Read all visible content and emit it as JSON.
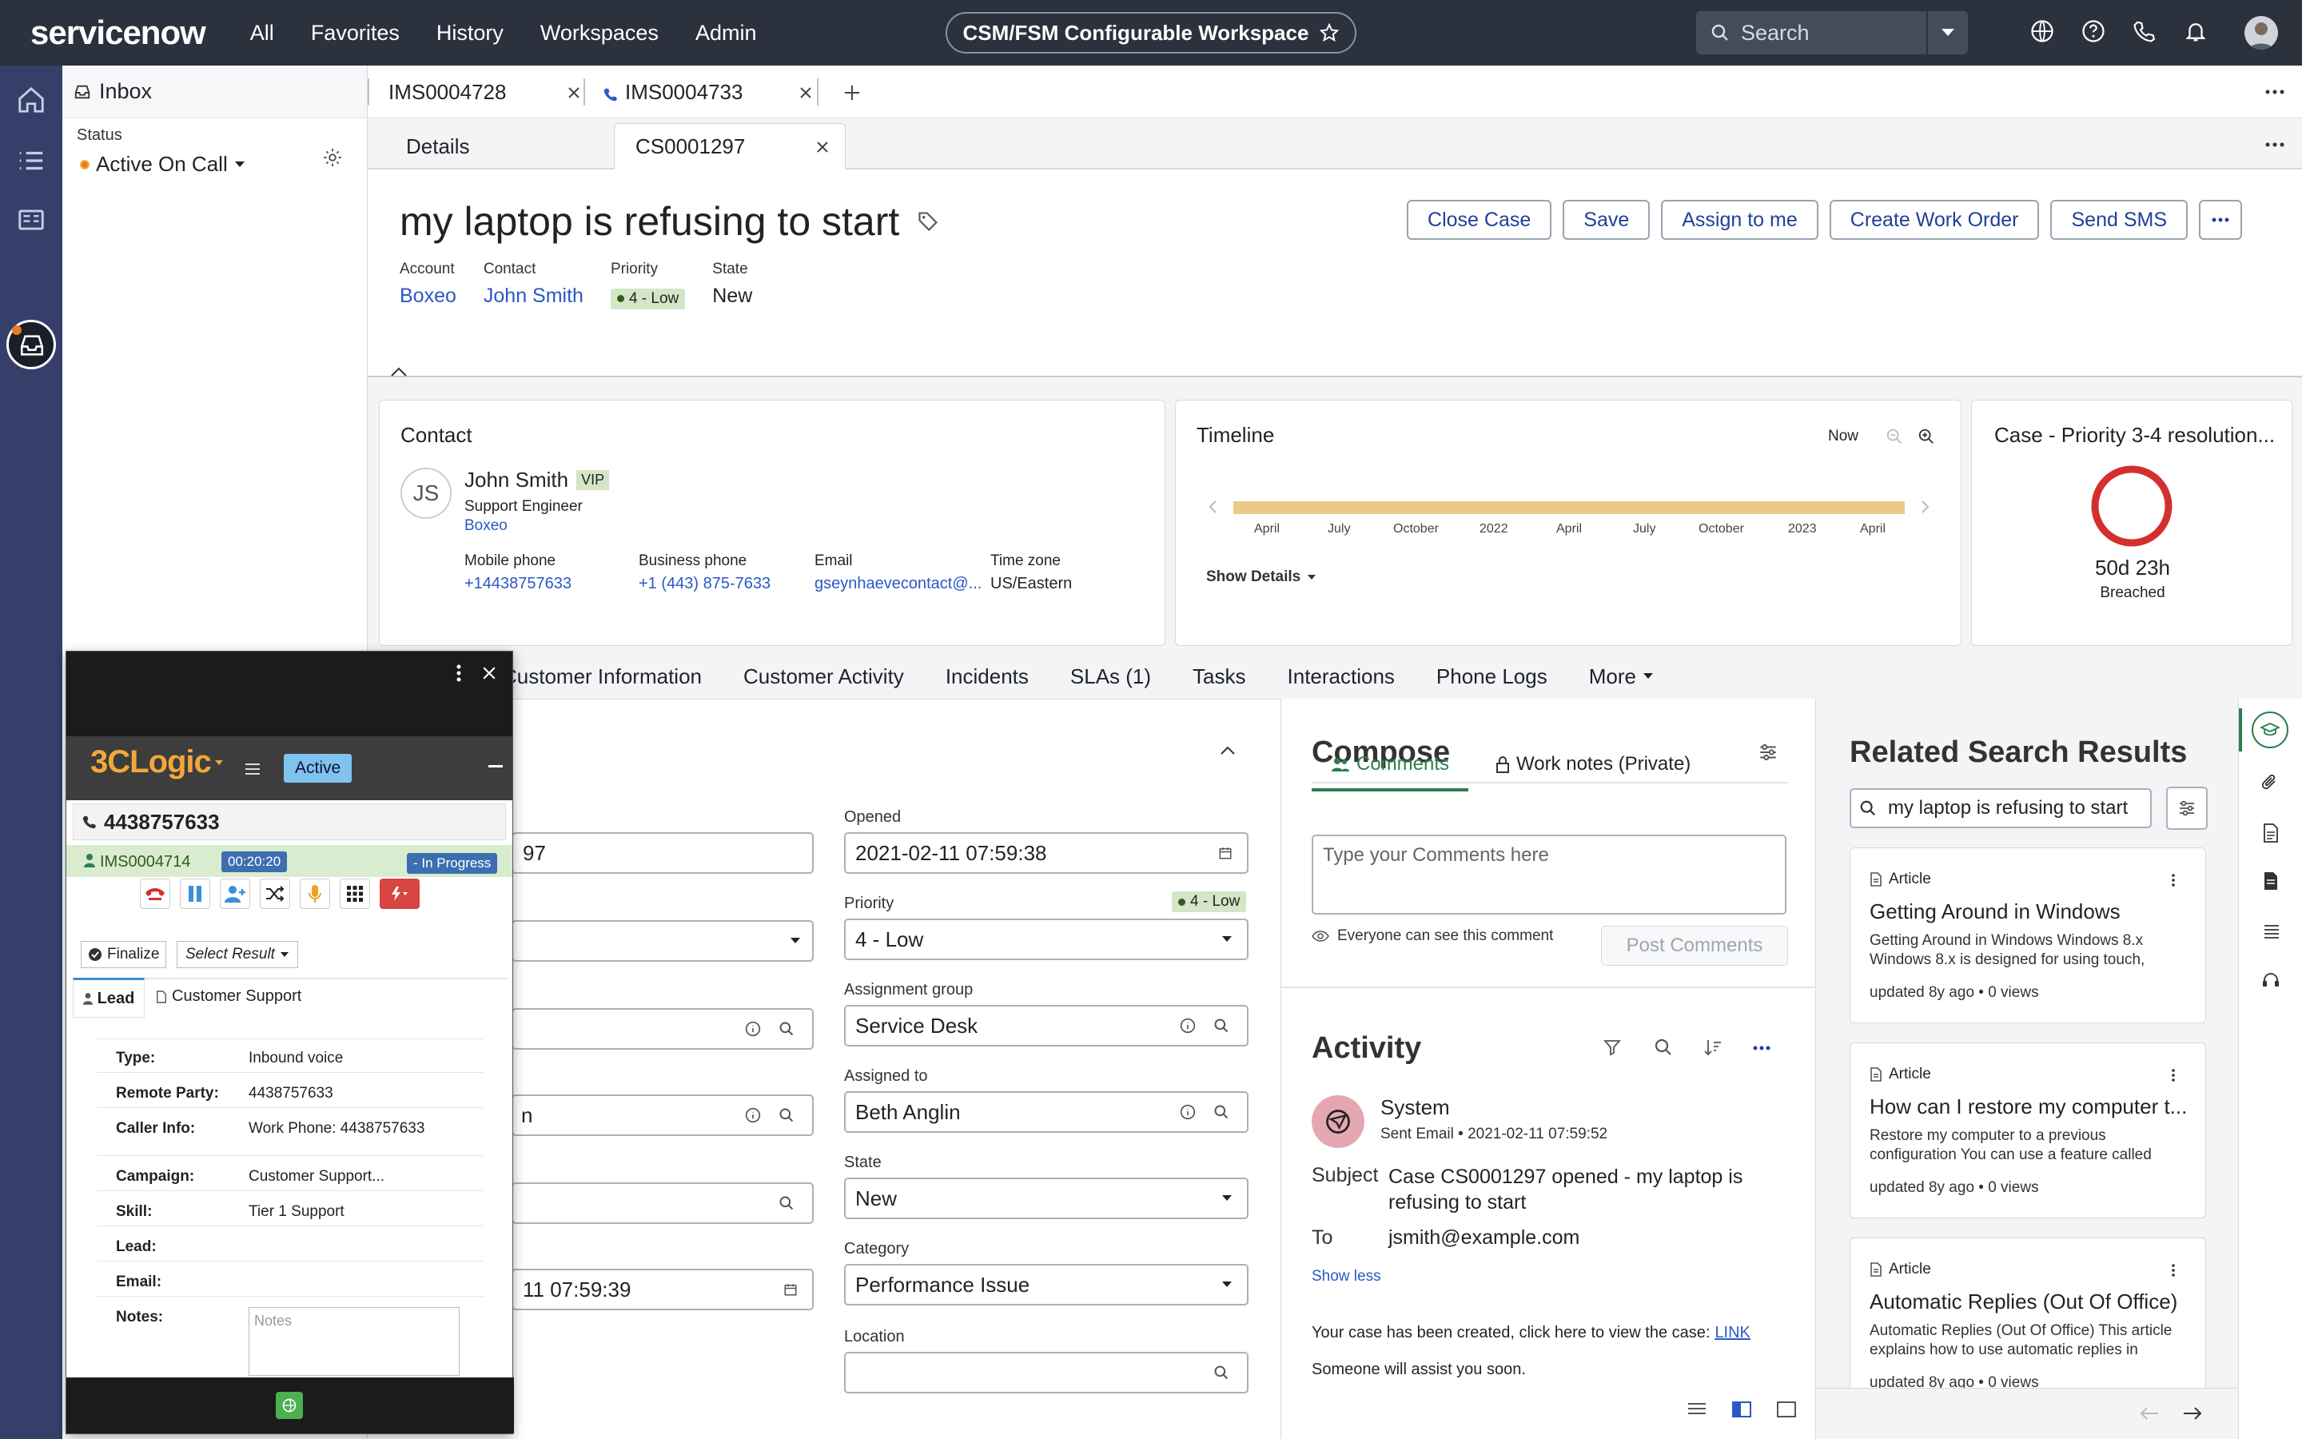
{
  "topnav": {
    "logo": "servicenow",
    "links": [
      "All",
      "Favorites",
      "History",
      "Workspaces",
      "Admin"
    ],
    "workspace": "CSM/FSM Configurable Workspace",
    "search_placeholder": "Search"
  },
  "inbox": {
    "title": "Inbox",
    "status_label": "Status",
    "status_value": "Active On Call"
  },
  "tabs": {
    "primary": [
      "IMS0004728",
      "IMS0004733"
    ],
    "secondary": [
      "Details",
      "CS0001297"
    ]
  },
  "case": {
    "title": "my laptop is refusing to start",
    "buttons": [
      "Close Case",
      "Save",
      "Assign to me",
      "Create Work Order",
      "Send SMS"
    ],
    "account_label": "Account",
    "account": "Boxeo",
    "contact_label": "Contact",
    "contact": "John Smith",
    "priority_label": "Priority",
    "priority": "4 - Low",
    "state_label": "State",
    "state": "New"
  },
  "contact_card": {
    "title": "Contact",
    "initials": "JS",
    "name": "John Smith",
    "vip": "VIP",
    "role": "Support Engineer",
    "company": "Boxeo",
    "mobile_label": "Mobile phone",
    "mobile": "+14438757633",
    "business_label": "Business phone",
    "business": "+1 (443) 875-7633",
    "email_label": "Email",
    "email": "gseynhaevecontact@...",
    "tz_label": "Time zone",
    "tz": "US/Eastern"
  },
  "timeline": {
    "title": "Timeline",
    "now": "Now",
    "ticks": [
      "April",
      "July",
      "October",
      "2022",
      "April",
      "July",
      "October",
      "2023",
      "April"
    ],
    "show_details": "Show Details"
  },
  "sla": {
    "title": "Case - Priority 3-4 resolution...",
    "time": "50d 23h",
    "status": "Breached",
    "ring_color": "#d32f2f"
  },
  "related_tabs": [
    "Customer Information",
    "Customer Activity",
    "Incidents",
    "SLAs (1)",
    "Tasks",
    "Interactions",
    "Phone Logs",
    "More"
  ],
  "form": {
    "number_value": "97",
    "opened_label": "Opened",
    "opened": "2021-02-11 07:59:38",
    "priority_label": "Priority",
    "priority": "4 - Low",
    "priority_badge": "4 - Low",
    "group_label": "Assignment group",
    "group": "Service Desk",
    "assigned_label": "Assigned to",
    "assigned": "Beth Anglin",
    "contact_partial": "n",
    "state_label": "State",
    "state": "New",
    "category_label": "Category",
    "category": "Performance Issue",
    "date_partial": "11 07:59:39",
    "location_label": "Location",
    "location": ""
  },
  "compose": {
    "title": "Compose",
    "tab_comments": "Comments",
    "tab_worknotes": "Work notes (Private)",
    "placeholder": "Type your Comments here",
    "visibility": "Everyone can see this comment",
    "post": "Post Comments"
  },
  "activity": {
    "title": "Activity",
    "sender": "System",
    "sent": "Sent Email • 2021-02-11 07:59:52",
    "subject_label": "Subject",
    "subject": "Case CS0001297 opened - my laptop is refusing to start",
    "to_label": "To",
    "to": "jsmith@example.com",
    "show_less": "Show less",
    "body1": "Your case has been created, click here to view the case:",
    "body_link": "LINK",
    "body2": "Someone will assist you soon."
  },
  "related": {
    "title": "Related Search Results",
    "query": "my laptop is refusing to start",
    "articles": [
      {
        "type": "Article",
        "title": "Getting Around in Windows",
        "snippet": "Getting Around in Windows Windows 8.x Windows 8.x is designed for using touch,",
        "meta": "updated 8y ago • 0 views"
      },
      {
        "type": "Article",
        "title": "How can I restore my computer t...",
        "snippet": "Restore my computer to a previous configuration You can use a feature called",
        "meta": "updated 8y ago • 0 views"
      },
      {
        "type": "Article",
        "title": "Automatic Replies (Out Of Office)",
        "snippet": "Automatic Replies (Out Of Office) This article explains how to use automatic replies in",
        "meta": "updated 8y ago • 0 views"
      }
    ]
  },
  "threeclogic": {
    "brand": "3CLogic",
    "status": "Active",
    "phone": "4438757633",
    "interaction": "IMS0004714",
    "timer": "00:20:20",
    "progress": "- In Progress",
    "finalize": "Finalize",
    "select_result": "Select Result",
    "tab_lead": "Lead",
    "tab_support": "Customer Support",
    "fields": [
      {
        "label": "Type:",
        "value": "Inbound voice"
      },
      {
        "label": "Remote Party:",
        "value": "4438757633"
      },
      {
        "label": "Caller Info:",
        "value": "Work Phone: 4438757633"
      },
      {
        "label": "Campaign:",
        "value": "Customer Support..."
      },
      {
        "label": "Skill:",
        "value": "Tier 1 Support"
      },
      {
        "label": "Lead:",
        "value": ""
      },
      {
        "label": "Email:",
        "value": ""
      },
      {
        "label": "Notes:",
        "value": ""
      }
    ],
    "notes_placeholder": "Notes"
  }
}
